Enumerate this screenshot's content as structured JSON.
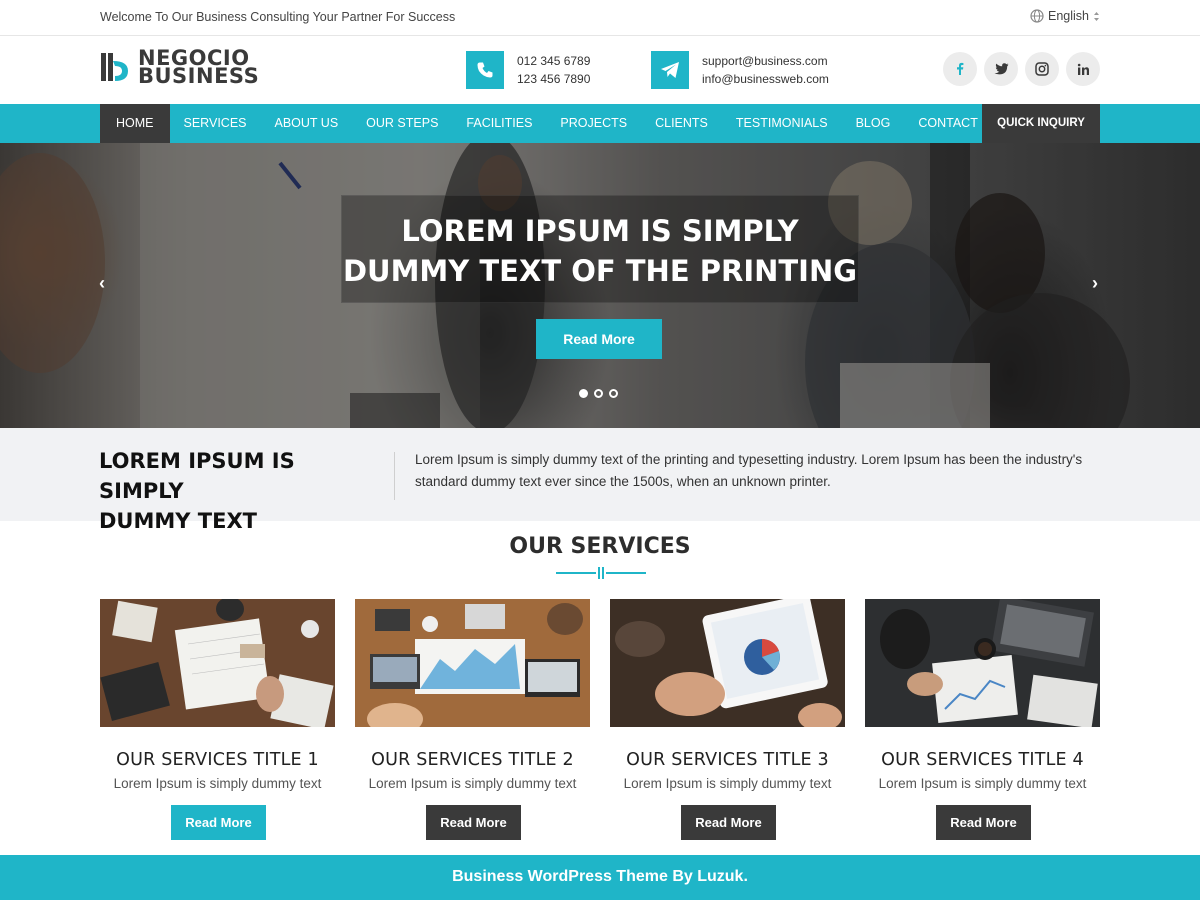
{
  "topbar": {
    "welcome": "Welcome To Our Business Consulting Your Partner For Success",
    "language": "English"
  },
  "logo": {
    "line1": "NEGOCIO",
    "line2": "BUSINESS"
  },
  "contacts": {
    "phone1": "012 345 6789",
    "phone2": "123 456 7890",
    "email1": "support@business.com",
    "email2": "info@businessweb.com"
  },
  "social": [
    "facebook-icon",
    "twitter-icon",
    "instagram-icon",
    "linkedin-icon"
  ],
  "nav": {
    "items": [
      "HOME",
      "SERVICES",
      "ABOUT US",
      "OUR STEPS",
      "FACILITIES",
      "PROJECTS",
      "CLIENTS",
      "TESTIMONIALS",
      "BLOG",
      "CONTACT"
    ],
    "active": "HOME",
    "quick": "QUICK INQUIRY"
  },
  "hero": {
    "title_line1": "LOREM IPSUM IS SIMPLY",
    "title_line2": "DUMMY TEXT OF THE PRINTING",
    "button": "Read More",
    "slide_count": 3,
    "active_slide": 1
  },
  "intro": {
    "heading_line1": "LOREM IPSUM IS SIMPLY",
    "heading_line2": "DUMMY TEXT",
    "text": "Lorem Ipsum is simply dummy text of the printing and typesetting industry. Lorem Ipsum has been the industry's standard dummy text ever since the 1500s, when an unknown printer."
  },
  "services": {
    "title": "OUR SERVICES",
    "items": [
      {
        "title": "OUR SERVICES TITLE 1",
        "text": "Lorem Ipsum is simply dummy text",
        "button": "Read More"
      },
      {
        "title": "OUR SERVICES TITLE 2",
        "text": "Lorem Ipsum is simply dummy text",
        "button": "Read More"
      },
      {
        "title": "OUR SERVICES TITLE 3",
        "text": "Lorem Ipsum is simply dummy text",
        "button": "Read More"
      },
      {
        "title": "OUR SERVICES TITLE 4",
        "text": "Lorem Ipsum is simply dummy text",
        "button": "Read More"
      }
    ]
  },
  "footer": {
    "text": "Business WordPress Theme By Luzuk."
  },
  "colors": {
    "accent": "#1fb5c8",
    "dark": "#3a3a3a",
    "intro_bg": "#f1f2f4"
  }
}
